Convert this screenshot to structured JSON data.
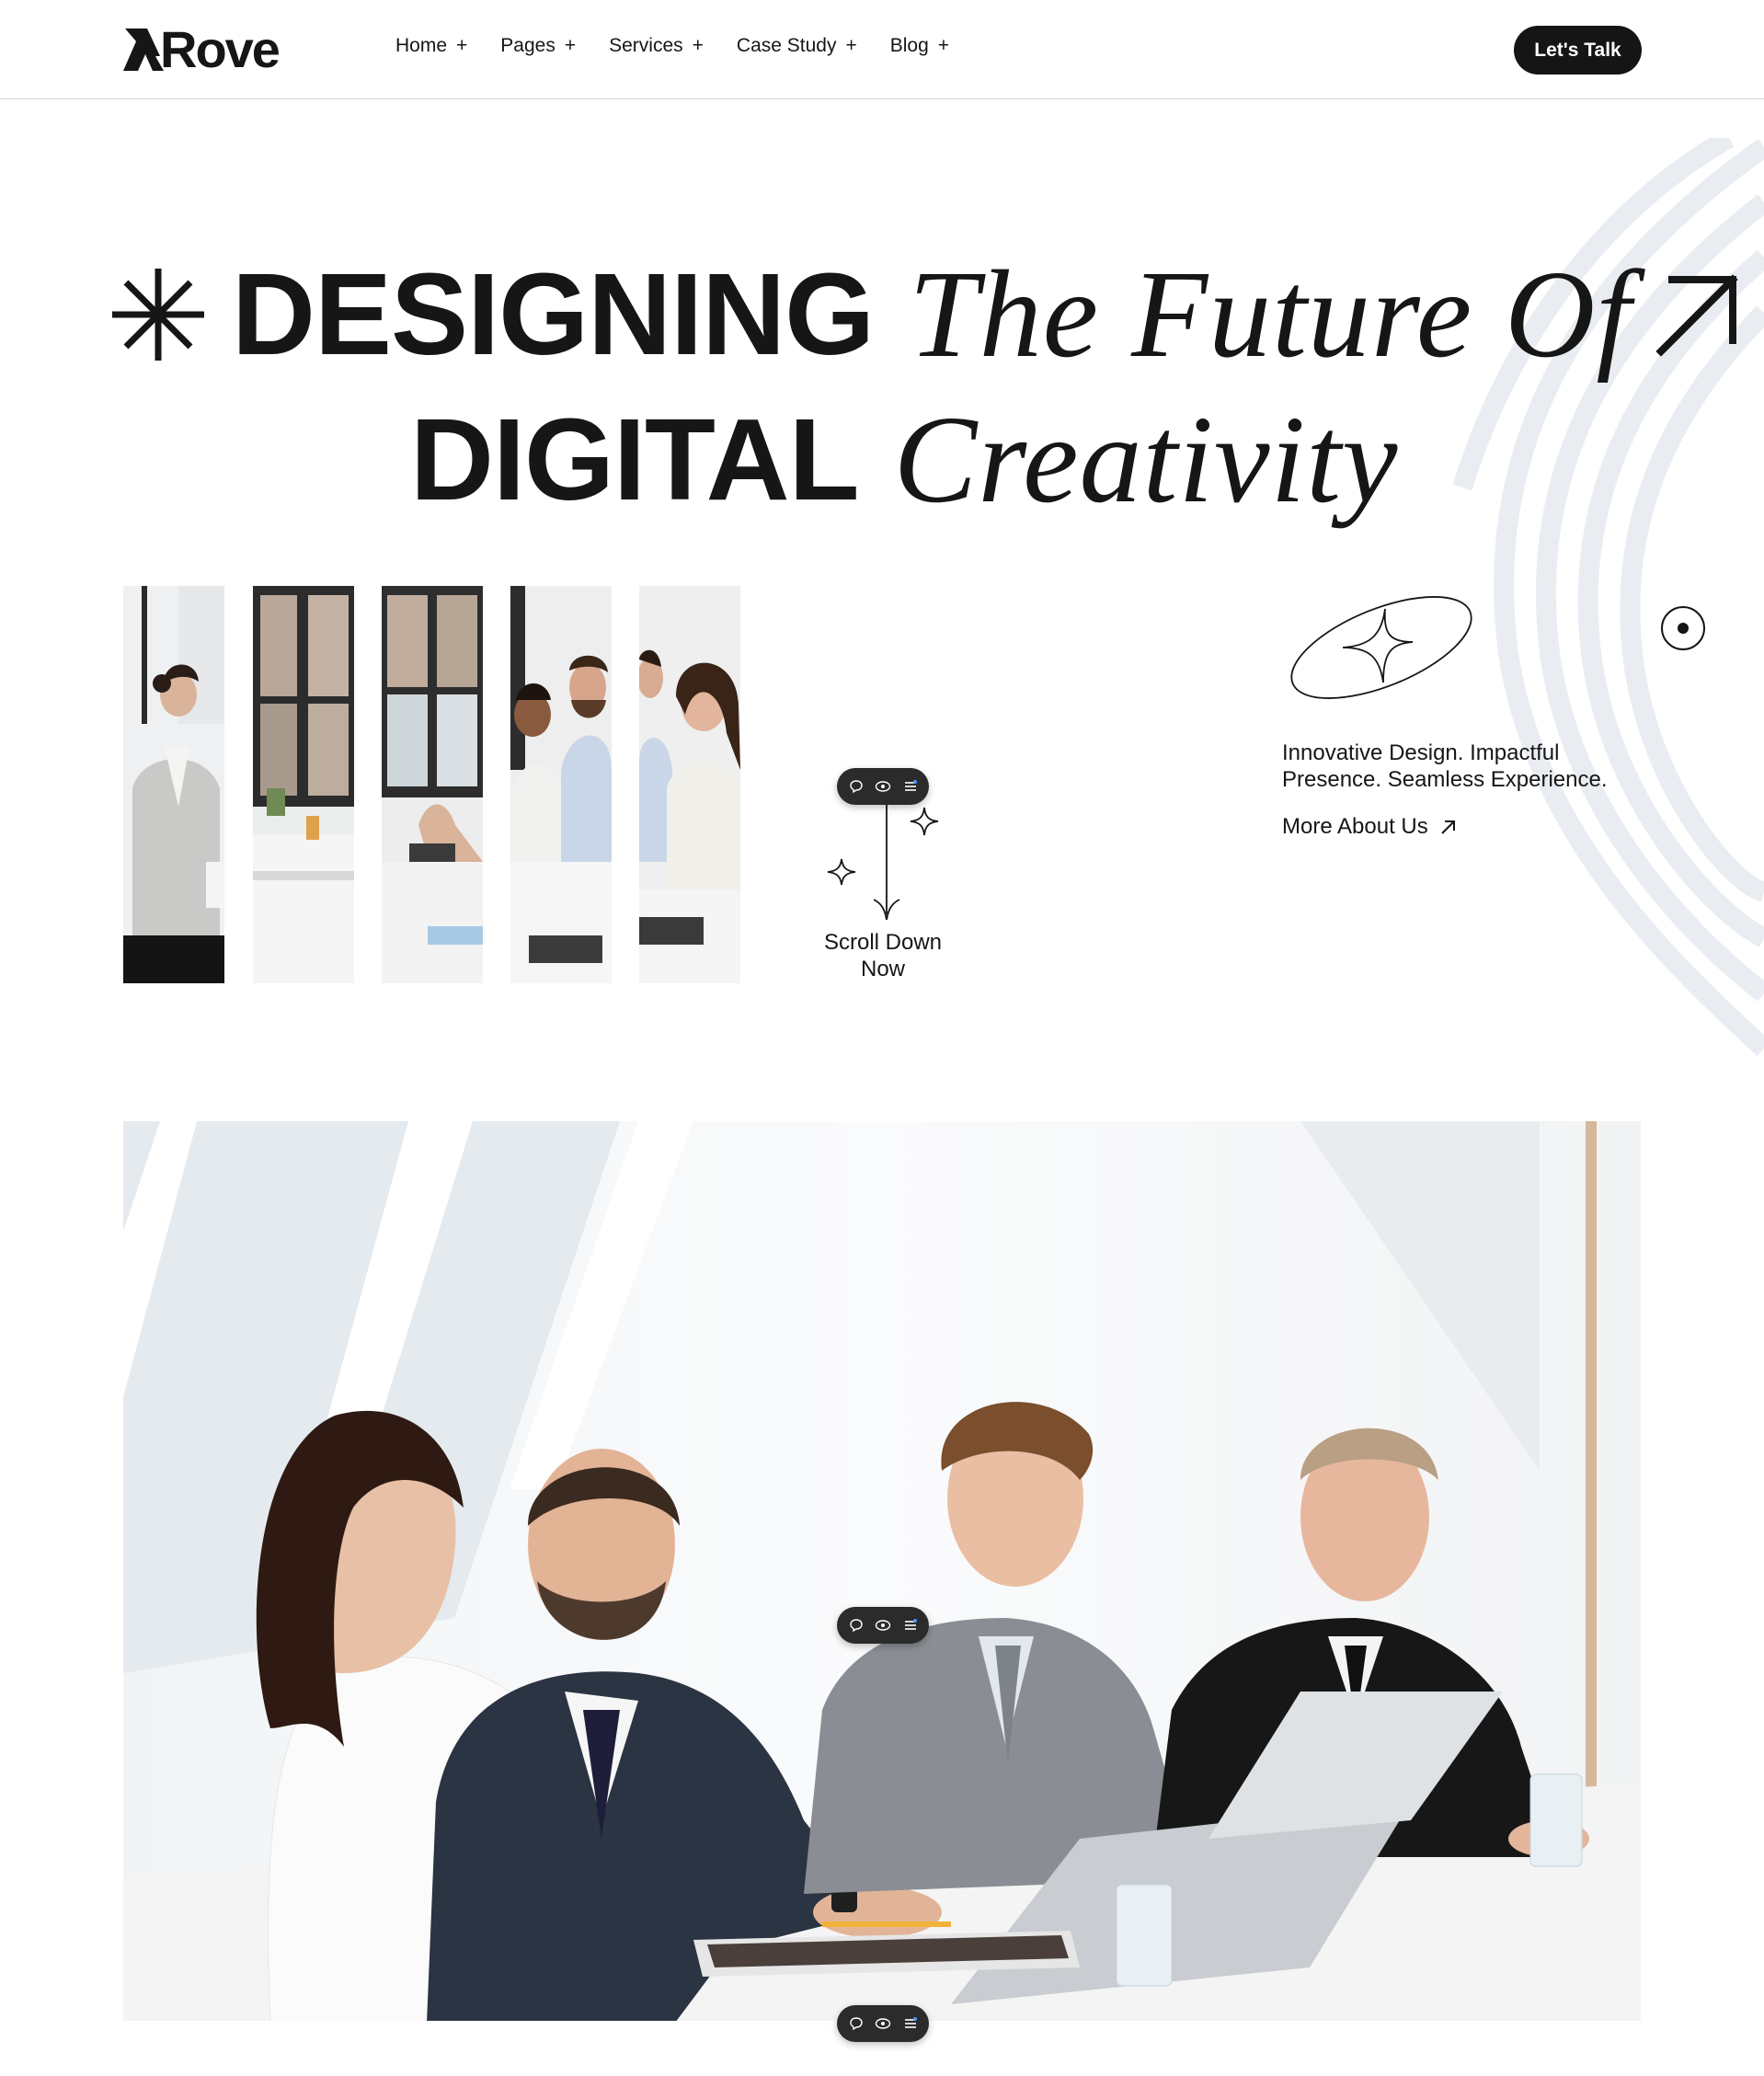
{
  "header": {
    "logo_text": "Rove",
    "nav": [
      {
        "label": "Home",
        "icon": "+"
      },
      {
        "label": "Pages",
        "icon": "+"
      },
      {
        "label": "Services",
        "icon": "+"
      },
      {
        "label": "Case Study",
        "icon": "+"
      },
      {
        "label": "Blog",
        "icon": "+"
      }
    ],
    "cta_label": "Let's Talk"
  },
  "hero": {
    "line1_sans": "DESIGNING",
    "line1_serif": "The Future Of",
    "line2_sans": "DIGITAL",
    "line2_serif": "Creativity"
  },
  "strips": {
    "count": 5,
    "photo_subject": "business meeting"
  },
  "scroll": {
    "label_line1": "Scroll Down",
    "label_line2": "Now"
  },
  "about": {
    "tagline_line1": "Innovative Design. Impactful",
    "tagline_line2": "Presence. Seamless Experience.",
    "link_label": "More About Us"
  },
  "widget_icons": [
    "comment-icon",
    "eye-icon",
    "list-icon"
  ],
  "colors": {
    "text": "#161616",
    "button_bg": "#151515",
    "button_text": "#ffffff",
    "decor_lines": "#e9edf2",
    "widget_bg": "#2b2b2b"
  }
}
